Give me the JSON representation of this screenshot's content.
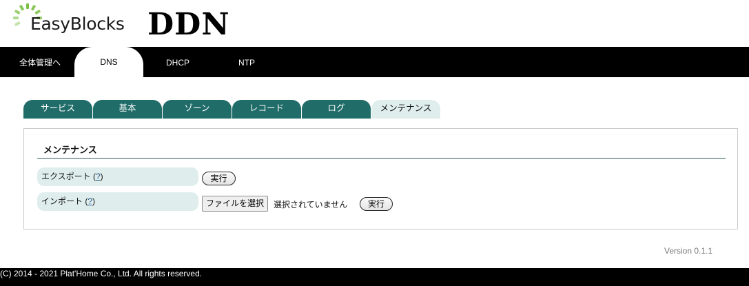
{
  "header": {
    "logo_text": "EasyBlocks",
    "host_name": "DDN"
  },
  "topnav": {
    "items": [
      {
        "label": "全体管理へ",
        "active": false
      },
      {
        "label": "DNS",
        "active": true
      },
      {
        "label": "DHCP",
        "active": false
      },
      {
        "label": "NTP",
        "active": false
      }
    ]
  },
  "subtabs": {
    "items": [
      {
        "label": "サービス",
        "active": false
      },
      {
        "label": "基本",
        "active": false
      },
      {
        "label": "ゾーン",
        "active": false
      },
      {
        "label": "レコード",
        "active": false
      },
      {
        "label": "ログ",
        "active": false
      },
      {
        "label": "メンテナンス",
        "active": true
      }
    ]
  },
  "panel": {
    "title": "メンテナンス",
    "export": {
      "label": "エクスポート",
      "help_open": "(",
      "help": "?",
      "help_close": ")",
      "button": "実行"
    },
    "import": {
      "label": "インポート",
      "help_open": "(",
      "help": "?",
      "help_close": ")",
      "file_button": "ファイルを選択",
      "file_status": "選択されていません",
      "button": "実行"
    }
  },
  "version": "Version 0.1.1",
  "footer": {
    "copyright": "(C) 2014 - 2021 Plat'Home Co., Ltd. All rights reserved."
  },
  "colors": {
    "tab_dark": "#206c69",
    "tab_light": "#dfeeed",
    "nav_bg": "#000000",
    "logo_green": "#7ac043"
  }
}
